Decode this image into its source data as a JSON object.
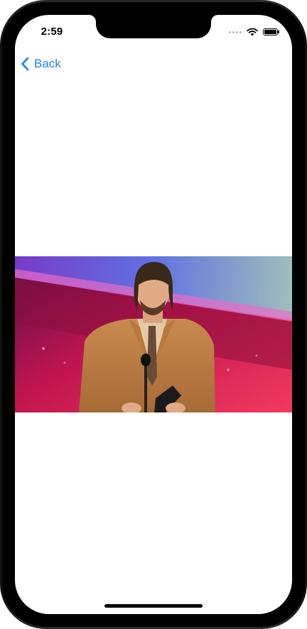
{
  "status_bar": {
    "time": "2:59",
    "icons": [
      "signal-dots-icon",
      "wifi-icon",
      "battery-icon"
    ]
  },
  "nav": {
    "back_label": "Back",
    "back_icon": "chevron-left-icon"
  },
  "accent_color": "#1a7ff0"
}
